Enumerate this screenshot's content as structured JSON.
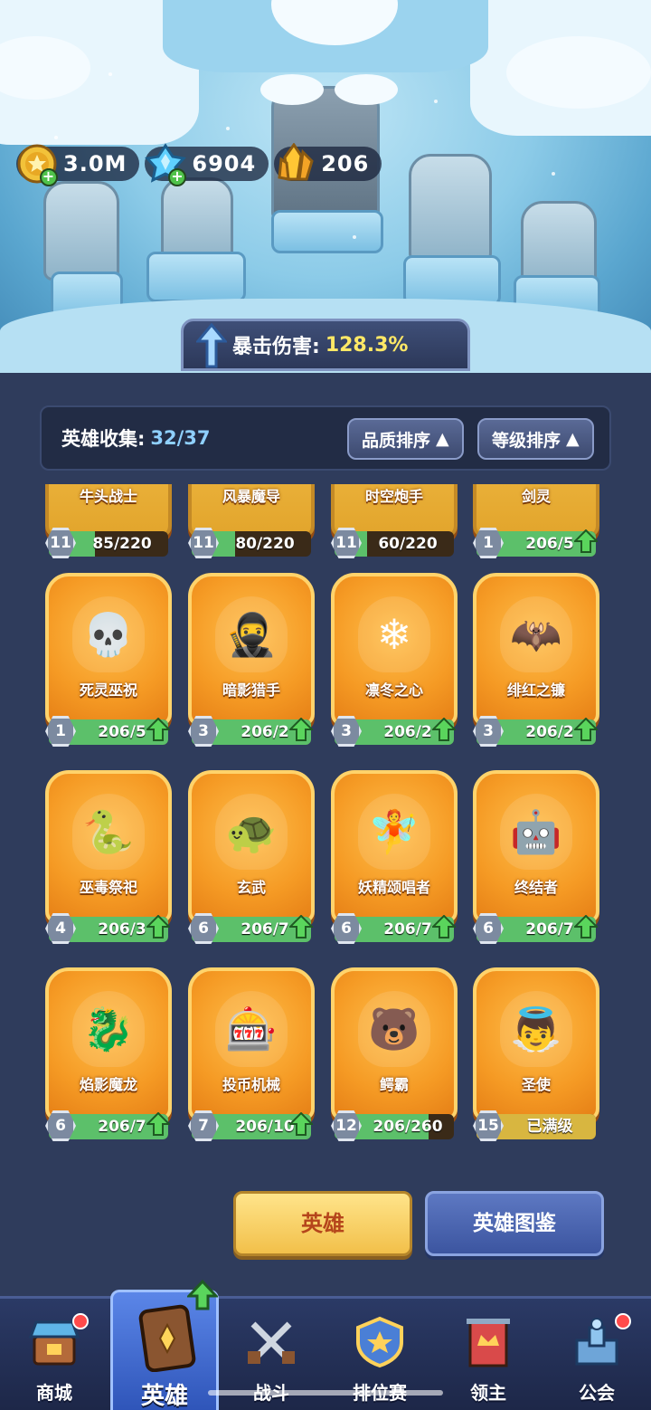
{
  "currency": {
    "gold": "3.0M",
    "diamond": "6904",
    "crystal": "206"
  },
  "banner": {
    "label": "暴击伤害:",
    "value": "128.3%"
  },
  "collection": {
    "label": "英雄收集:",
    "count": "32/37",
    "sort_quality": "品质排序",
    "sort_level": "等级排序"
  },
  "heroes_top": [
    {
      "name": "牛头战士",
      "level": "11",
      "progress": "85/220",
      "fill": 0.39,
      "upgrade": false
    },
    {
      "name": "风暴魔导",
      "level": "11",
      "progress": "80/220",
      "fill": 0.36,
      "upgrade": false
    },
    {
      "name": "时空炮手",
      "level": "11",
      "progress": "60/220",
      "fill": 0.27,
      "upgrade": false
    },
    {
      "name": "剑灵",
      "level": "1",
      "progress": "206/5",
      "fill": 1,
      "upgrade": true
    }
  ],
  "heroes": [
    {
      "name": "死灵巫祝",
      "level": "1",
      "progress": "206/5",
      "fill": 1,
      "upgrade": true,
      "icon": "💀"
    },
    {
      "name": "暗影猎手",
      "level": "3",
      "progress": "206/2",
      "fill": 1,
      "upgrade": true,
      "icon": "🥷"
    },
    {
      "name": "凛冬之心",
      "level": "3",
      "progress": "206/2",
      "fill": 1,
      "upgrade": true,
      "icon": "❄"
    },
    {
      "name": "绯红之镰",
      "level": "3",
      "progress": "206/2",
      "fill": 1,
      "upgrade": true,
      "icon": "🦇"
    },
    {
      "name": "巫毒祭祀",
      "level": "4",
      "progress": "206/3",
      "fill": 1,
      "upgrade": true,
      "icon": "🐍"
    },
    {
      "name": "玄武",
      "level": "6",
      "progress": "206/7",
      "fill": 1,
      "upgrade": true,
      "icon": "🐢"
    },
    {
      "name": "妖精颂唱者",
      "level": "6",
      "progress": "206/7",
      "fill": 1,
      "upgrade": true,
      "icon": "🧚"
    },
    {
      "name": "终结者",
      "level": "6",
      "progress": "206/7",
      "fill": 1,
      "upgrade": true,
      "icon": "🤖"
    },
    {
      "name": "焰影魔龙",
      "level": "6",
      "progress": "206/7",
      "fill": 1,
      "upgrade": true,
      "icon": "🐉"
    },
    {
      "name": "投币机械",
      "level": "7",
      "progress": "206/10",
      "fill": 1,
      "upgrade": true,
      "icon": "🎰"
    },
    {
      "name": "鳄霸",
      "level": "12",
      "progress": "206/260",
      "fill": 0.79,
      "upgrade": false,
      "icon": "🐻"
    },
    {
      "name": "圣使",
      "level": "15",
      "progress": "已满级",
      "fill": 1,
      "upgrade": false,
      "max": true,
      "icon": "👼"
    }
  ],
  "buttons": {
    "hero": "英雄",
    "atlas": "英雄图鉴"
  },
  "nav": {
    "shop": "商城",
    "hero": "英雄",
    "battle": "战斗",
    "rank": "排位赛",
    "lord": "领主",
    "guild": "公会"
  },
  "colors": {
    "panel": "#2f3c5c",
    "card_orange": "#f59a24",
    "progress_green": "#5cc06a",
    "highlight_yellow": "#ffe866"
  }
}
